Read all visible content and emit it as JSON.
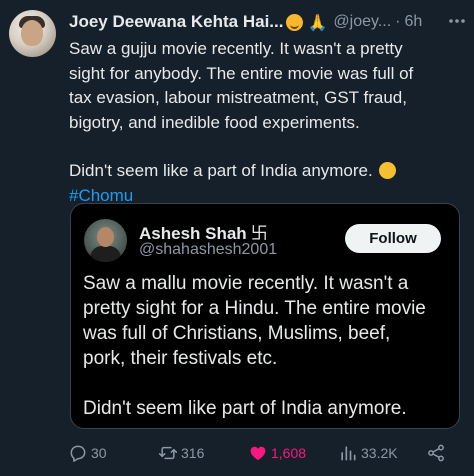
{
  "tweet": {
    "display_name": "Joey Deewana Kehta Hai...",
    "handle": "@joey...",
    "separator": "·",
    "time": "6h",
    "lines": [
      "Saw a gujju movie recently. It wasn't a pretty",
      "sight for anybody. The entire movie was full of",
      "tax evasion, labour mistreatment, GST fraud,",
      "bigotry, and inedible food experiments."
    ],
    "closing": "Didn't seem like a part of India anymore.",
    "hashtag": "#Chomu"
  },
  "quote": {
    "display_name": "Ashesh Shah",
    "name_symbol": "卐",
    "handle": "@shahashesh2001",
    "follow_label": "Follow",
    "lines": [
      "Saw a mallu movie recently. It wasn't a",
      "pretty sight for a Hindu. The entire movie",
      "was full of Christians, Muslims, beef,",
      "pork, their festivals etc."
    ],
    "closing": "Didn't seem like part of India anymore."
  },
  "actions": {
    "replies": "30",
    "reposts": "316",
    "likes": "1,608",
    "views": "33.2K"
  },
  "colors": {
    "background": "#15202b",
    "quote_background": "#000000",
    "accent": "#1d9bf0",
    "like": "#f91880",
    "muted": "#8b98a5"
  },
  "icons": [
    "relieved-face-icon",
    "folded-hands-icon",
    "more-icon",
    "smiling-tear-face-icon",
    "reply-icon",
    "repost-icon",
    "like-icon",
    "views-icon",
    "share-icon"
  ]
}
